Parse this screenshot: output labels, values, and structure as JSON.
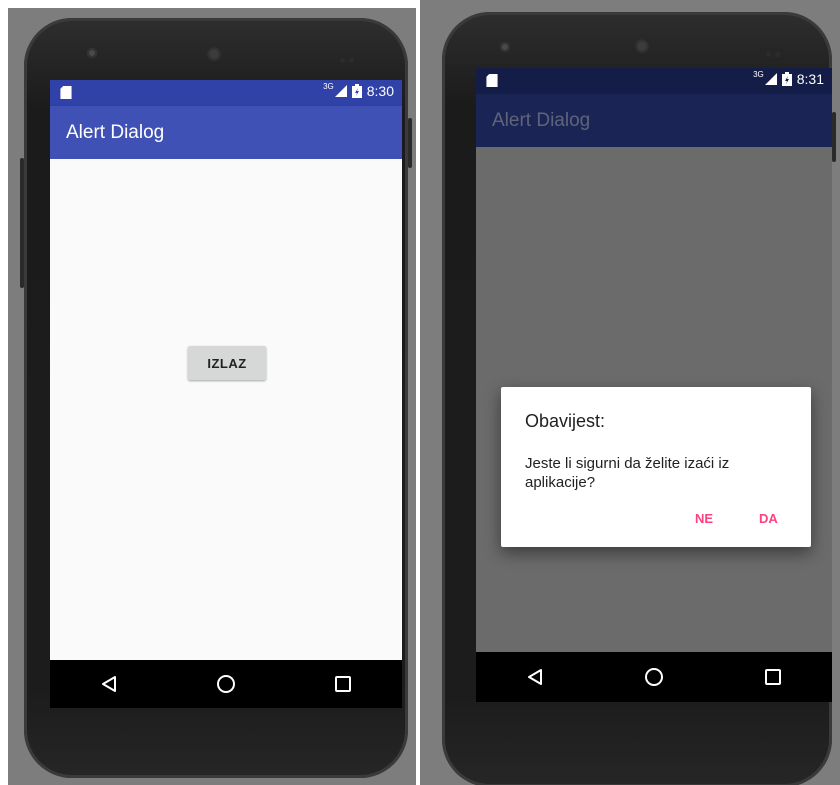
{
  "left": {
    "status": {
      "network": "3G",
      "time": "8:30"
    },
    "app_title": "Alert Dialog",
    "button_label": "IZLAZ"
  },
  "right": {
    "status": {
      "network": "3G",
      "time": "8:31"
    },
    "app_title": "Alert Dialog",
    "dialog": {
      "title": "Obavijest:",
      "message": "Jeste li sigurni da želite izaći iz aplikacije?",
      "negative": "NE",
      "positive": "DA"
    }
  },
  "nav": {
    "back": "back-icon",
    "home": "home-icon",
    "recents": "recents-icon"
  },
  "colors": {
    "primary": "#3f51b5",
    "primary_dark": "#3041a8",
    "accent": "#ff4081",
    "dim_appbar": "#1a2556",
    "dim_content": "#6b6b6b"
  }
}
